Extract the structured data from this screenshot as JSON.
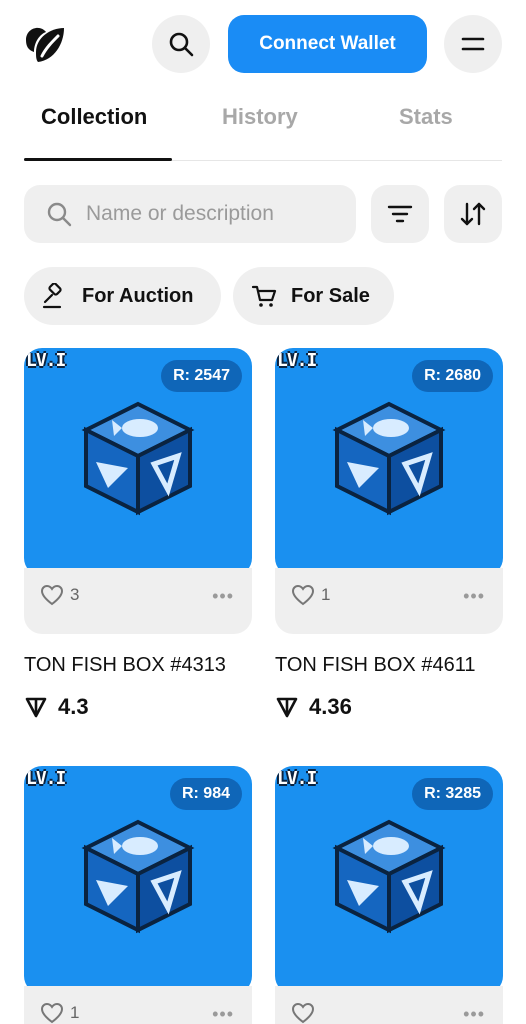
{
  "header": {
    "logo_icon": "leaf-logo-icon",
    "search_icon": "search-icon",
    "connect_label": "Connect Wallet",
    "menu_icon": "menu-icon",
    "accent_color": "#1a8cf5"
  },
  "tabs": [
    {
      "label": "Collection",
      "active": true
    },
    {
      "label": "History",
      "active": false
    },
    {
      "label": "Stats",
      "active": false
    }
  ],
  "search": {
    "placeholder": "Name or description",
    "value": ""
  },
  "toolbar": {
    "filter_icon": "filter-icon",
    "sort_icon": "sort-icon"
  },
  "chips": [
    {
      "label": "For Auction",
      "icon": "gavel-icon"
    },
    {
      "label": "For Sale",
      "icon": "cart-icon"
    }
  ],
  "cards": [
    {
      "level": "LV.I",
      "rarity": "R: 2547",
      "likes": "3",
      "more": "•••",
      "name": "TON FISH BOX #4313",
      "price": "4.3"
    },
    {
      "level": "LV.I",
      "rarity": "R: 2680",
      "likes": "1",
      "more": "•••",
      "name": "TON FISH BOX #4611",
      "price": "4.36"
    },
    {
      "level": "LV.I",
      "rarity": "R: 984",
      "likes": "1",
      "more": "•••",
      "name": "",
      "price": ""
    },
    {
      "level": "LV.I",
      "rarity": "R: 3285",
      "likes": "",
      "more": "•••",
      "name": "",
      "price": ""
    }
  ]
}
